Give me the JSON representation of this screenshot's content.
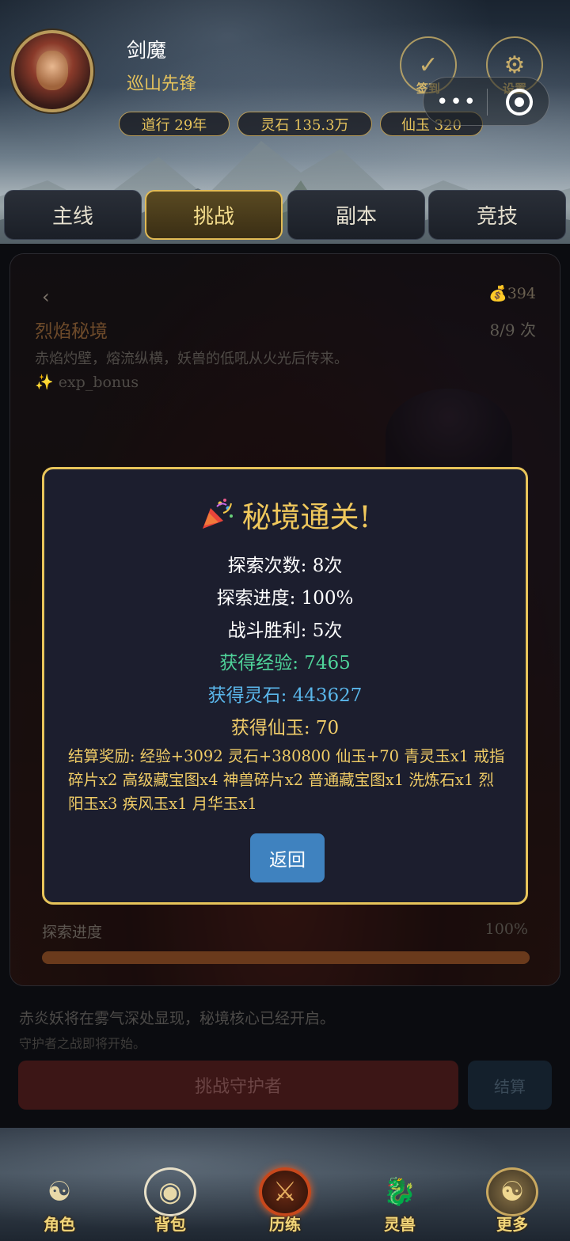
{
  "player": {
    "name": "剑魔",
    "rank": "巡山先锋",
    "stats": [
      "道行 29年",
      "灵石 135.3万",
      "仙玉 320"
    ]
  },
  "header_icons": [
    {
      "label": "签到",
      "icon": "checkmark-icon"
    },
    {
      "label": "设置",
      "icon": "gear-icon"
    }
  ],
  "tabs": [
    {
      "label": "主线",
      "active": false
    },
    {
      "label": "挑战",
      "active": true
    },
    {
      "label": "副本",
      "active": false
    },
    {
      "label": "竞技",
      "active": false
    }
  ],
  "dungeon": {
    "back": "‹",
    "coins": "💰394",
    "name": "烈焰秘境",
    "attempts": "8/9 次",
    "description": "赤焰灼壁，熔流纵横，妖兽的低吼从火光后传来。",
    "buff": "✨ exp_bonus",
    "progress_label": "探索进度",
    "progress_text": "100%",
    "progress_value": 1.0
  },
  "hints": {
    "line1": "赤炎妖将在雾气深处显现，秘境核心已经开启。",
    "line2": "守护者之战即将开始。"
  },
  "buttons": {
    "challenge": "挑战守护者",
    "settle": "结算"
  },
  "modal": {
    "title": "秘境通关!",
    "lines": [
      "探索次数: 8次",
      "探索进度: 100%",
      "战斗胜利: 5次",
      "获得经验: 7465",
      "获得灵石: 443627",
      "获得仙玉: 70"
    ],
    "rewards": "结算奖励: 经验+3092 灵石+380800 仙玉+70 青灵玉x1 戒指碎片x2 高级藏宝图x4 神兽碎片x2 普通藏宝图x1 洗炼石x1 烈阳玉x3 疾风玉x1 月华玉x1",
    "return_label": "返回"
  },
  "bottom_nav": [
    {
      "label": "角色",
      "icon": "character-icon"
    },
    {
      "label": "背包",
      "icon": "bag-icon"
    },
    {
      "label": "历练",
      "icon": "crossed-swords-icon"
    },
    {
      "label": "灵兽",
      "icon": "dragon-icon"
    },
    {
      "label": "更多",
      "icon": "more-icon"
    }
  ],
  "colors": {
    "gold": "#e6c35c",
    "modal_border": "#e7c45a",
    "exp_green": "#4fd49a",
    "stone_blue": "#5ab6ea",
    "return_button": "#3f82bf"
  }
}
